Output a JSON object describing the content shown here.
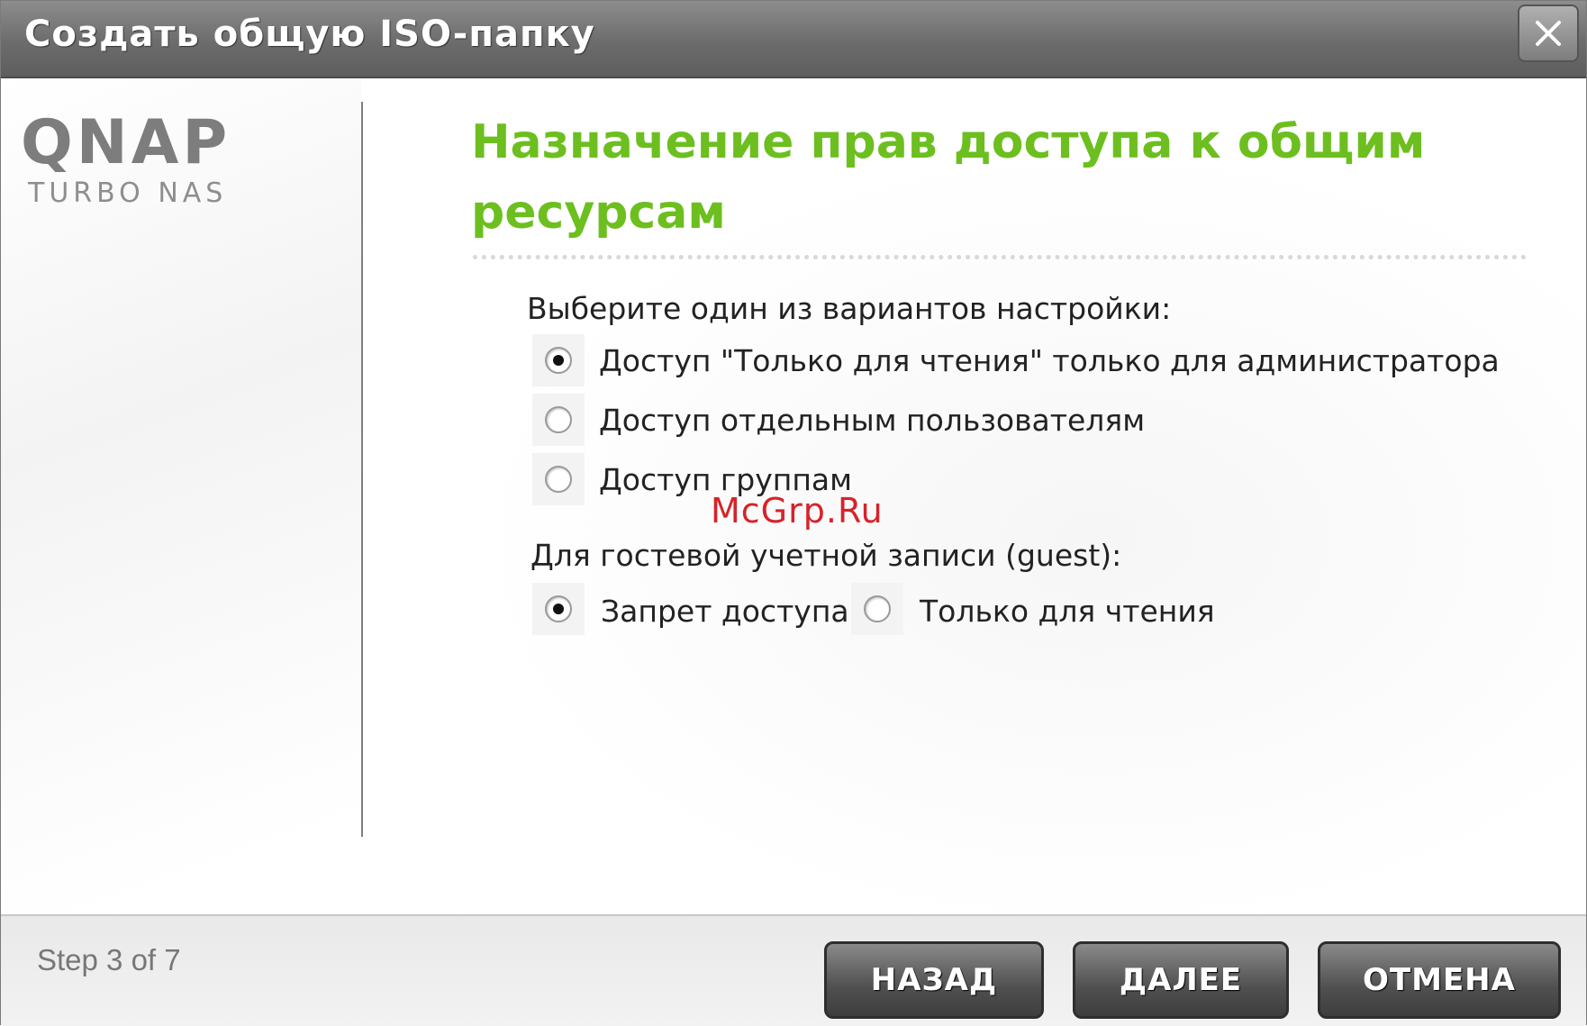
{
  "window": {
    "title": "Создать общую ISO-папку",
    "close_icon": "close-icon"
  },
  "sidebar": {
    "logo_text": "QNAP",
    "logo_subtitle": "TURBO NAS"
  },
  "main": {
    "heading": "Назначение прав доступа к общим ресурсам",
    "select_label": "Выберите один из вариантов настройки:",
    "access_options": [
      {
        "label": "Доступ \"Только для чтения\" только для администратора",
        "checked": true
      },
      {
        "label": "Доступ отдельным пользователям",
        "checked": false
      },
      {
        "label": "Доступ группам",
        "checked": false
      }
    ],
    "guest_label": "Для гостевой учетной записи (guest):",
    "guest_options": [
      {
        "label": "Запрет доступа",
        "checked": true
      },
      {
        "label": "Только для чтения",
        "checked": false
      }
    ],
    "watermark": "McGrp.Ru"
  },
  "footer": {
    "step": "Step 3 of 7",
    "back_label": "НАЗАД",
    "next_label": "ДАЛЕЕ",
    "cancel_label": "ОТМЕНА"
  },
  "colors": {
    "heading": "#6cbf1f",
    "titlebar": "#6c6c6c",
    "button": "#505050"
  }
}
